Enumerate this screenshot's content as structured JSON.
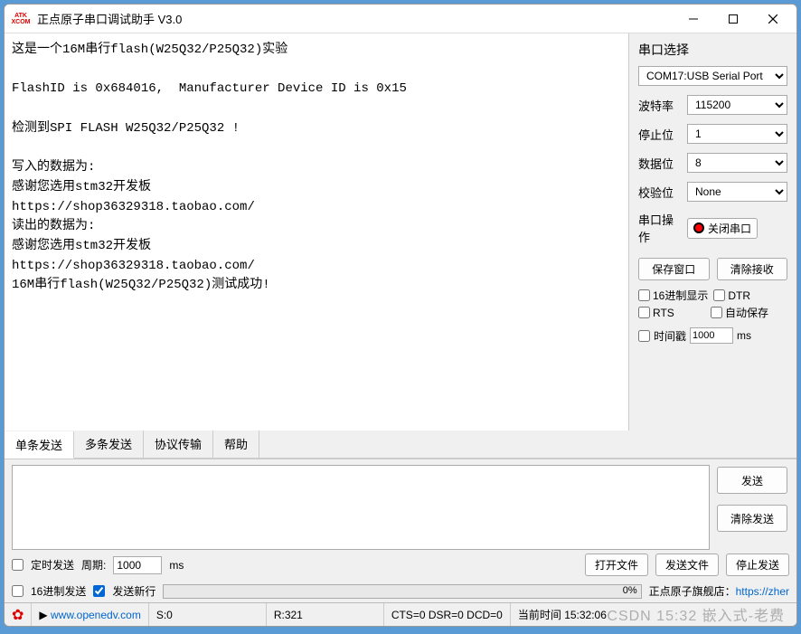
{
  "titlebar": {
    "logo_top": "ATK",
    "logo_bottom": "XCOM",
    "title": "正点原子串口调试助手 V3.0"
  },
  "console_text": "这是一个16M串行flash(W25Q32/P25Q32)实验\n\nFlashID is 0x684016,  Manufacturer Device ID is 0x15\n\n检测到SPI FLASH W25Q32/P25Q32 !\n\n写入的数据为:\n感谢您选用stm32开发板\nhttps://shop36329318.taobao.com/\n读出的数据为:\n感谢您选用stm32开发板\nhttps://shop36329318.taobao.com/\n16M串行flash(W25Q32/P25Q32)测试成功!",
  "side": {
    "title": "串口选择",
    "port": "COM17:USB Serial Port",
    "baud_label": "波特率",
    "baud": "115200",
    "stop_label": "停止位",
    "stop": "1",
    "data_label": "数据位",
    "data": "8",
    "parity_label": "校验位",
    "parity": "None",
    "op_label": "串口操作",
    "op_btn": "关闭串口",
    "save_window": "保存窗口",
    "clear_recv": "清除接收",
    "hex_display": "16进制显示",
    "dtr": "DTR",
    "rts": "RTS",
    "autosave": "自动保存",
    "timestamp": "时间戳",
    "timestamp_val": "1000",
    "timestamp_unit": "ms"
  },
  "tabs": {
    "single": "单条发送",
    "multi": "多条发送",
    "proto": "协议传输",
    "help": "帮助"
  },
  "send": {
    "send_btn": "发送",
    "clear_btn": "清除发送"
  },
  "options": {
    "timed_send": "定时发送",
    "period_label": "周期:",
    "period_val": "1000",
    "period_unit": "ms",
    "open_file": "打开文件",
    "send_file": "发送文件",
    "stop_send": "停止发送",
    "hex_send": "16进制发送",
    "send_newline": "发送新行",
    "progress_pct": "0%",
    "store_label": "正点原子旗舰店：",
    "store_link": "https://zher"
  },
  "status": {
    "url": "www.openedv.com",
    "s": "S:0",
    "r": "R:321",
    "lines": "CTS=0 DSR=0 DCD=0",
    "time": "当前时间 15:32:06"
  },
  "watermark": "CSDN 15:32 嵌入式-老费"
}
